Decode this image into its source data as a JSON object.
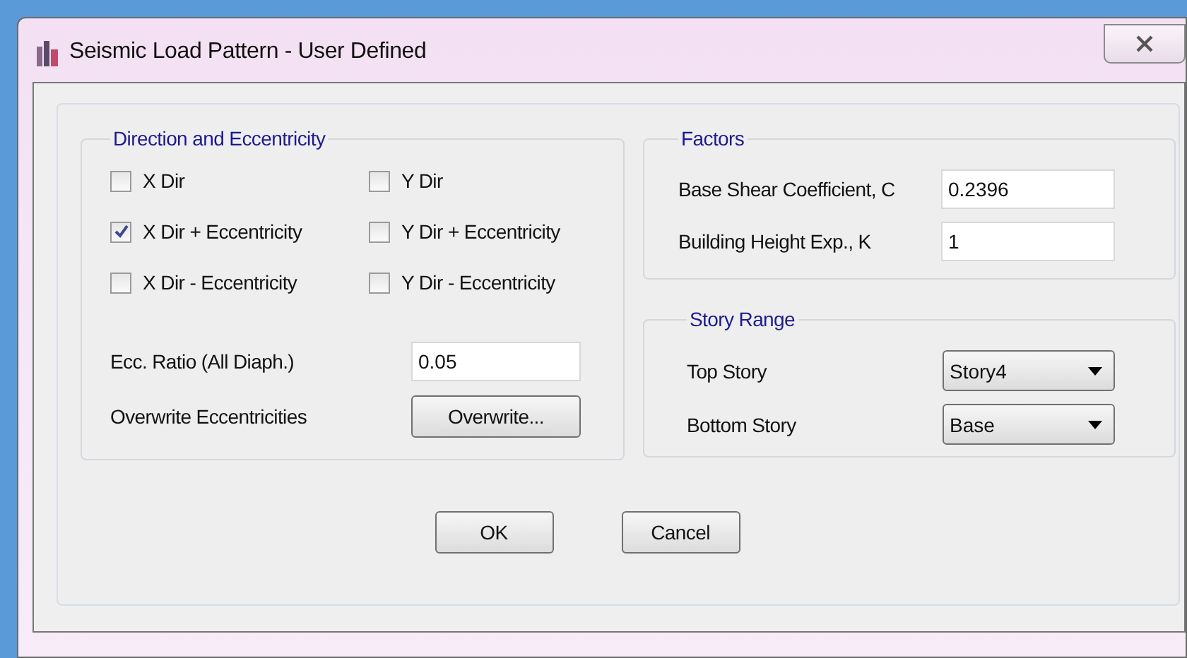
{
  "window": {
    "title": "Seismic Load Pattern - User Defined"
  },
  "direction": {
    "title": "Direction and Eccentricity",
    "checkboxes": [
      {
        "label": "X Dir",
        "checked": false
      },
      {
        "label": "Y Dir",
        "checked": false
      },
      {
        "label": "X Dir + Eccentricity",
        "checked": true
      },
      {
        "label": "Y Dir + Eccentricity",
        "checked": false
      },
      {
        "label": "X Dir - Eccentricity",
        "checked": false
      },
      {
        "label": "Y Dir - Eccentricity",
        "checked": false
      }
    ],
    "ecc_ratio": {
      "label": "Ecc. Ratio (All Diaph.)",
      "value": "0.05"
    },
    "overwrite": {
      "label": "Overwrite Eccentricities",
      "button": "Overwrite..."
    }
  },
  "factors": {
    "title": "Factors",
    "fields": [
      {
        "label": "Base Shear Coefficient, C",
        "value": "0.2396"
      },
      {
        "label": "Building Height Exp., K",
        "value": "1"
      }
    ]
  },
  "story_range": {
    "title": "Story Range",
    "dropdowns": [
      {
        "label": "Top Story",
        "value": "Story4"
      },
      {
        "label": "Bottom Story",
        "value": "Base"
      }
    ]
  },
  "buttons": [
    "OK",
    "Cancel"
  ]
}
